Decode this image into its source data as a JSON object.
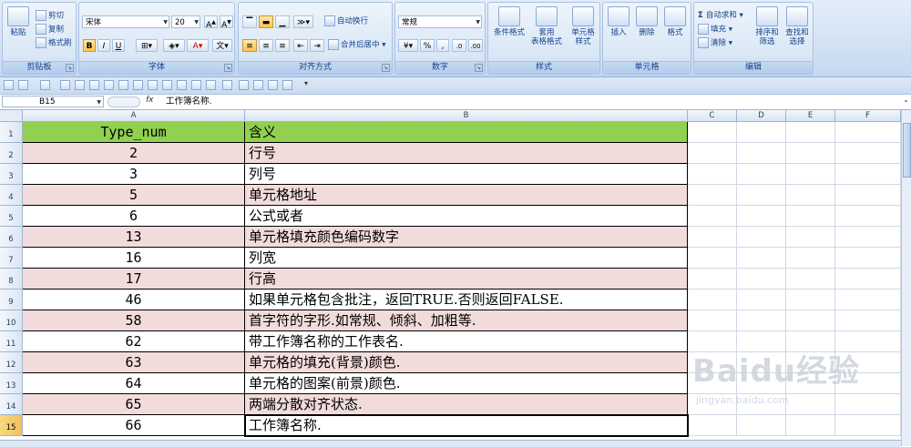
{
  "ribbon": {
    "clipboard": {
      "paste": "粘贴",
      "cut": "剪切",
      "copy": "复制",
      "format_painter": "格式刷",
      "label": "剪贴板"
    },
    "font": {
      "font_name": "宋体",
      "font_size": "20",
      "bold": "B",
      "italic": "I",
      "underline": "U",
      "label": "字体"
    },
    "alignment": {
      "wrap_text": "自动换行",
      "merge_center": "合并后居中",
      "label": "对齐方式"
    },
    "number": {
      "format": "常规",
      "percent": "%",
      "comma": ",",
      "label": "数字"
    },
    "styles": {
      "conditional": "条件格式",
      "table_format": "套用\n表格格式",
      "cell_styles": "单元格\n样式",
      "label": "样式"
    },
    "cells": {
      "insert": "插入",
      "delete": "删除",
      "format": "格式",
      "label": "单元格"
    },
    "editing": {
      "autosum": "自动求和",
      "fill": "填充",
      "clear": "清除",
      "sort_filter": "排序和\n筛选",
      "find_select": "查找和\n选择",
      "label": "编辑"
    }
  },
  "formula_bar": {
    "name_box": "B15",
    "fx": "fx",
    "content": "工作簿名称."
  },
  "columns": [
    "A",
    "B",
    "C",
    "D",
    "E",
    "F"
  ],
  "rows": [
    {
      "num": "1",
      "a": "Type_num",
      "b": "含义"
    },
    {
      "num": "2",
      "a": "2",
      "b": "行号"
    },
    {
      "num": "3",
      "a": "3",
      "b": "列号"
    },
    {
      "num": "4",
      "a": "5",
      "b": "单元格地址"
    },
    {
      "num": "5",
      "a": "6",
      "b": "公式或者"
    },
    {
      "num": "6",
      "a": "13",
      "b": "单元格填充颜色编码数字"
    },
    {
      "num": "7",
      "a": "16",
      "b": "列宽"
    },
    {
      "num": "8",
      "a": "17",
      "b": "行高"
    },
    {
      "num": "9",
      "a": "46",
      "b": "如果单元格包含批注，返回TRUE.否则返回FALSE."
    },
    {
      "num": "10",
      "a": "58",
      "b": "首字符的字形.如常规、倾斜、加粗等."
    },
    {
      "num": "11",
      "a": "62",
      "b": "带工作簿名称的工作表名."
    },
    {
      "num": "12",
      "a": "63",
      "b": "单元格的填充(背景)颜色."
    },
    {
      "num": "13",
      "a": "64",
      "b": "单元格的图案(前景)颜色."
    },
    {
      "num": "14",
      "a": "65",
      "b": "两端分散对齐状态."
    },
    {
      "num": "15",
      "a": "66",
      "b": "工作簿名称."
    }
  ],
  "colors": {
    "header_fill": "#92d050",
    "stripe_fill": "#f2dcdb",
    "selected_row_header": "#f1c15f"
  },
  "watermark": {
    "logo": "Baidu经验",
    "url": "jingyan.baidu.com"
  }
}
